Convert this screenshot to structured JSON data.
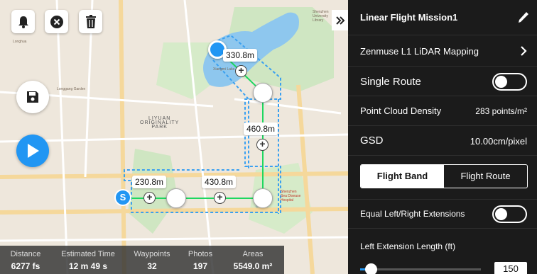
{
  "toolbar": {
    "bell_icon": "bell-icon",
    "close_icon": "close-icon",
    "trash_icon": "trash-icon",
    "collapse_icon": "double-chevron-right-icon"
  },
  "map": {
    "labels": [
      "Shenzhen University Library",
      "Liyuan Originality Park",
      "Xiangmi Lake Garden",
      "Longgang Garden",
      "Shenzhen Sea Disease Hospital"
    ],
    "route_labels": [
      "330.8m",
      "460.8m",
      "230.8m",
      "430.8m"
    ],
    "start_marker": "S"
  },
  "stats": {
    "distance_label": "Distance",
    "distance_value": "6277 fs",
    "time_label": "Estimated Time",
    "time_value": "12 m 49 s",
    "waypoints_label": "Waypoints",
    "waypoints_value": "32",
    "photos_label": "Photos",
    "photos_value": "197",
    "areas_label": "Areas",
    "areas_value": "5549.0 m²"
  },
  "panel": {
    "mission_title": "Linear Flight Mission1",
    "payload": "Zenmuse L1 LiDAR Mapping",
    "single_route_label": "Single Route",
    "single_route_on": false,
    "density_label": "Point Cloud Density",
    "density_value": "283 points/m²",
    "gsd_label": "GSD",
    "gsd_value": "10.00cm/pixel",
    "tabs": [
      "Flight Band",
      "Flight Route"
    ],
    "active_tab": "Flight Band",
    "equal_ext_label": "Equal Left/Right Extensions",
    "equal_ext_on": false,
    "left_ext_label": "Left Extension Length (ft)",
    "left_ext_value": "150"
  },
  "colors": {
    "accent": "#2196f3",
    "route": "#1ed760",
    "panel_bg": "#1b1b1b"
  }
}
